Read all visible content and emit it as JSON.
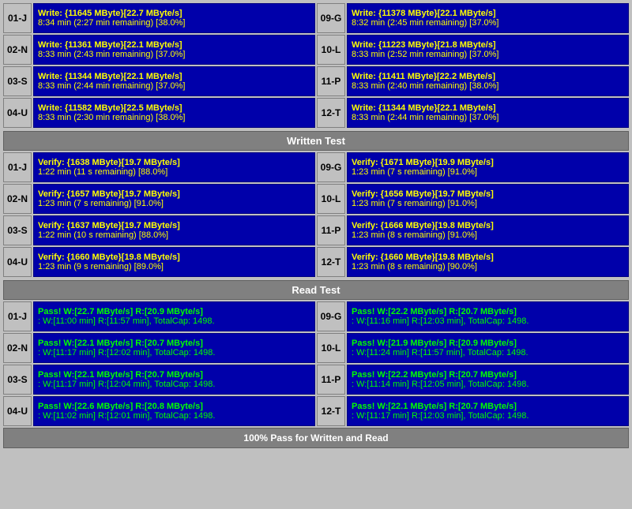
{
  "write_section": {
    "rows": [
      {
        "left_label": "01-J",
        "left_line1": "Write: {11645 MByte}[22.7 MByte/s]",
        "left_line2": "8:34 min (2:27 min remaining)  [38.0%]",
        "right_label": "09-G",
        "right_line1": "Write: {11378 MByte}[22.1 MByte/s]",
        "right_line2": "8:32 min (2:45 min remaining)  [37.0%]"
      },
      {
        "left_label": "02-N",
        "left_line1": "Write: {11361 MByte}[22.1 MByte/s]",
        "left_line2": "8:33 min (2:43 min remaining)  [37.0%]",
        "right_label": "10-L",
        "right_line1": "Write: {11223 MByte}[21.8 MByte/s]",
        "right_line2": "8:33 min (2:52 min remaining)  [37.0%]"
      },
      {
        "left_label": "03-S",
        "left_line1": "Write: {11344 MByte}[22.1 MByte/s]",
        "left_line2": "8:33 min (2:44 min remaining)  [37.0%]",
        "right_label": "11-P",
        "right_line1": "Write: {11411 MByte}[22.2 MByte/s]",
        "right_line2": "8:33 min (2:40 min remaining)  [38.0%]"
      },
      {
        "left_label": "04-U",
        "left_line1": "Write: {11582 MByte}[22.5 MByte/s]",
        "left_line2": "8:33 min (2:30 min remaining)  [38.0%]",
        "right_label": "12-T",
        "right_line1": "Write: {11344 MByte}[22.1 MByte/s]",
        "right_line2": "8:33 min (2:44 min remaining)  [37.0%]"
      }
    ],
    "header": "Written Test"
  },
  "verify_section": {
    "rows": [
      {
        "left_label": "01-J",
        "left_line1": "Verify: {1638 MByte}[19.7 MByte/s]",
        "left_line2": "1:22 min (11 s remaining)   [88.0%]",
        "right_label": "09-G",
        "right_line1": "Verify: {1671 MByte}[19.9 MByte/s]",
        "right_line2": "1:23 min (7 s remaining)   [91.0%]"
      },
      {
        "left_label": "02-N",
        "left_line1": "Verify: {1657 MByte}[19.7 MByte/s]",
        "left_line2": "1:23 min (7 s remaining)   [91.0%]",
        "right_label": "10-L",
        "right_line1": "Verify: {1656 MByte}[19.7 MByte/s]",
        "right_line2": "1:23 min (7 s remaining)   [91.0%]"
      },
      {
        "left_label": "03-S",
        "left_line1": "Verify: {1637 MByte}[19.7 MByte/s]",
        "left_line2": "1:22 min (10 s remaining)   [88.0%]",
        "right_label": "11-P",
        "right_line1": "Verify: {1666 MByte}[19.8 MByte/s]",
        "right_line2": "1:23 min (8 s remaining)   [91.0%]"
      },
      {
        "left_label": "04-U",
        "left_line1": "Verify: {1660 MByte}[19.8 MByte/s]",
        "left_line2": "1:23 min (9 s remaining)   [89.0%]",
        "right_label": "12-T",
        "right_line1": "Verify: {1660 MByte}[19.8 MByte/s]",
        "right_line2": "1:23 min (8 s remaining)   [90.0%]"
      }
    ],
    "header": "Read Test"
  },
  "read_section": {
    "rows": [
      {
        "left_label": "01-J",
        "left_line1": "Pass! W:[22.7 MByte/s] R:[20.9 MByte/s]",
        "left_line2": ": W:[11:00 min] R:[11:57 min], TotalCap: 1498.",
        "right_label": "09-G",
        "right_line1": "Pass! W:[22.2 MByte/s] R:[20.7 MByte/s]",
        "right_line2": ": W:[11:16 min] R:[12:03 min], TotalCap: 1498."
      },
      {
        "left_label": "02-N",
        "left_line1": "Pass! W:[22.1 MByte/s] R:[20.7 MByte/s]",
        "left_line2": ": W:[11:17 min] R:[12:02 min], TotalCap: 1498.",
        "right_label": "10-L",
        "right_line1": "Pass! W:[21.9 MByte/s] R:[20.9 MByte/s]",
        "right_line2": ": W:[11:24 min] R:[11:57 min], TotalCap: 1498."
      },
      {
        "left_label": "03-S",
        "left_line1": "Pass! W:[22.1 MByte/s] R:[20.7 MByte/s]",
        "left_line2": ": W:[11:17 min] R:[12:04 min], TotalCap: 1498.",
        "right_label": "11-P",
        "right_line1": "Pass! W:[22.2 MByte/s] R:[20.7 MByte/s]",
        "right_line2": ": W:[11:14 min] R:[12:05 min], TotalCap: 1498."
      },
      {
        "left_label": "04-U",
        "left_line1": "Pass! W:[22.6 MByte/s] R:[20.8 MByte/s]",
        "left_line2": ": W:[11:02 min] R:[12:01 min], TotalCap: 1498.",
        "right_label": "12-T",
        "right_line1": "Pass! W:[22.1 MByte/s] R:[20.7 MByte/s]",
        "right_line2": ": W:[11:17 min] R:[12:03 min], TotalCap: 1498."
      }
    ],
    "header": "Read Test"
  },
  "footer": "100% Pass for Written and Read"
}
